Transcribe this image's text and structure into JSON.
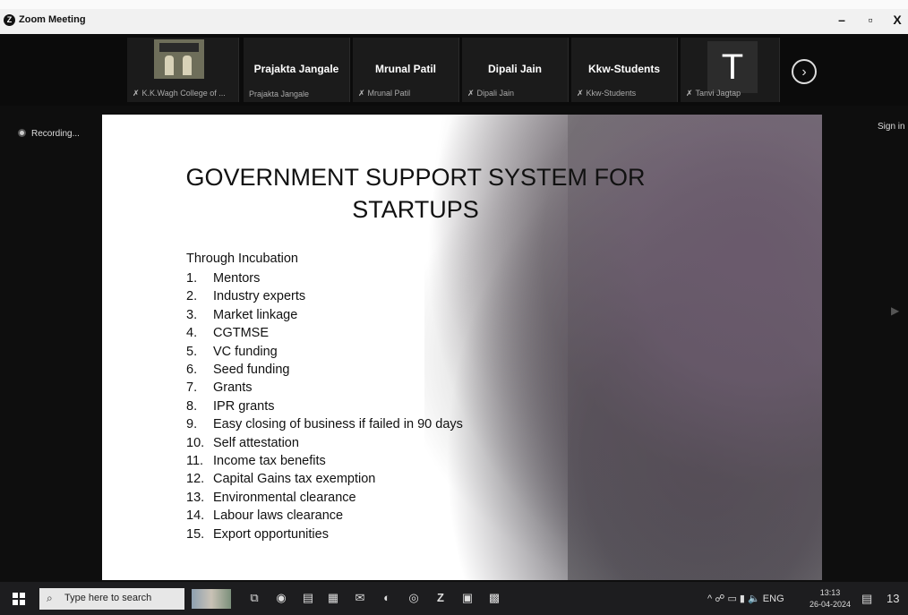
{
  "window": {
    "title": "Zoom Meeting",
    "controls": {
      "minimize": "–",
      "restore": "▫",
      "close": "X"
    }
  },
  "participants": [
    {
      "display": "",
      "label": "K.K.Wagh College of ..."
    },
    {
      "display": "Prajakta Jangale",
      "label": "Prajakta Jangale"
    },
    {
      "display": "Mrunal Patil",
      "label": "Mrunal Patil"
    },
    {
      "display": "Dipali Jain",
      "label": "Dipali Jain"
    },
    {
      "display": "Kkw-Students",
      "label": "Kkw-Students"
    },
    {
      "display": "T",
      "label": "Tanvi Jagtap"
    }
  ],
  "next_button": "›",
  "recording_label": "Recording...",
  "signin_label": "Sign in",
  "slide": {
    "title_line1": "GOVERNMENT SUPPORT SYSTEM FOR",
    "title_line2": "STARTUPS",
    "intro": "Through Incubation",
    "items": [
      {
        "n": "1.",
        "text": "Mentors"
      },
      {
        "n": "2.",
        "text": "Industry experts"
      },
      {
        "n": "3.",
        "text": "Market linkage"
      },
      {
        "n": "4.",
        "text": "CGTMSE"
      },
      {
        "n": "5.",
        "text": "VC funding"
      },
      {
        "n": "6.",
        "text": "Seed funding"
      },
      {
        "n": "7.",
        "text": "Grants"
      },
      {
        "n": "8.",
        "text": "IPR grants"
      },
      {
        "n": "9.",
        "text": "Easy closing of business if failed in 90 days"
      },
      {
        "n": "10.",
        "text": "Self attestation"
      },
      {
        "n": "11.",
        "text": "Income tax benefits"
      },
      {
        "n": "12.",
        "text": "Capital Gains tax exemption"
      },
      {
        "n": "13.",
        "text": "Environmental clearance"
      },
      {
        "n": "14.",
        "text": "Labour laws clearance"
      },
      {
        "n": "15.",
        "text": "Export opportunities"
      }
    ]
  },
  "taskbar": {
    "search_placeholder": "Type here to search",
    "tray_lang": "ENG",
    "time": "13:13",
    "date": "26-04-2024",
    "notification_count": "13"
  }
}
